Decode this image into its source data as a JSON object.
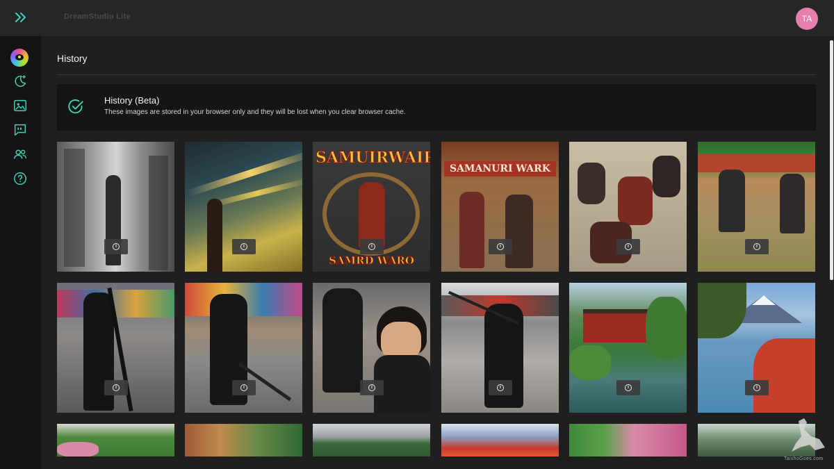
{
  "header": {
    "app_title": "DreamStudio Lite",
    "avatar_initials": "TA"
  },
  "sidebar": {
    "items": [
      {
        "name": "dream",
        "icon": "moon-star-icon"
      },
      {
        "name": "gallery",
        "icon": "image-icon"
      },
      {
        "name": "community",
        "icon": "chat-quote-icon"
      },
      {
        "name": "team",
        "icon": "users-icon"
      },
      {
        "name": "help",
        "icon": "help-circle-icon"
      }
    ]
  },
  "page": {
    "title": "History"
  },
  "notice": {
    "title": "History (Beta)",
    "text": "These images are stored in your browser only and they will be lost when you clear browser cache."
  },
  "gallery": {
    "info_label": "i",
    "banner_texts": [
      "SAMUIRWAIR",
      "SAMRD WARO",
      "SAMANURI WARK"
    ]
  },
  "watermark": {
    "text": "TaishoGoes.com"
  },
  "colors": {
    "accent": "#3fd4b5",
    "avatar": "#e77fae",
    "background": "#1f1f1f",
    "sidebar": "#141414"
  }
}
